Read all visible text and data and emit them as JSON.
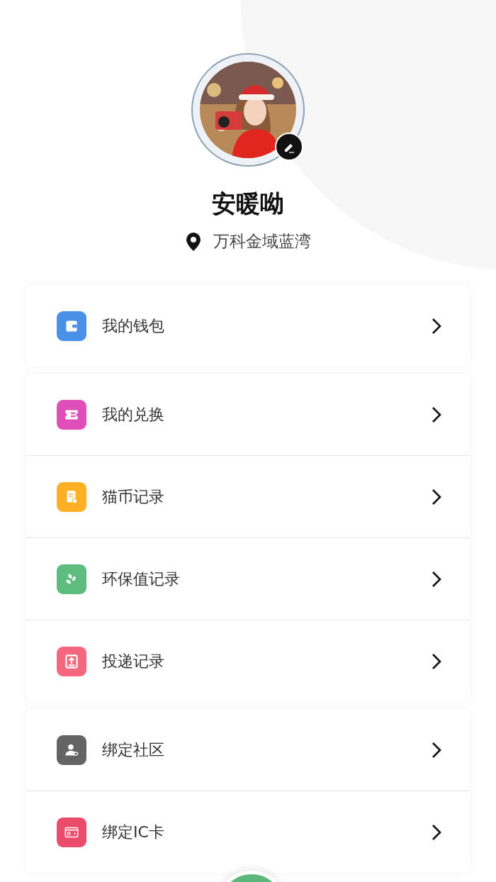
{
  "profile": {
    "name": "安暖呦",
    "location": "万科金域蓝湾"
  },
  "menu_groups": [
    {
      "items": [
        {
          "kind": "wallet",
          "label": "我的钱包"
        }
      ]
    },
    {
      "items": [
        {
          "kind": "ticket",
          "label": "我的兑换"
        },
        {
          "kind": "document",
          "label": "猫币记录"
        },
        {
          "kind": "leaf",
          "label": "环保值记录"
        },
        {
          "kind": "upload",
          "label": "投递记录"
        }
      ]
    },
    {
      "items": [
        {
          "kind": "user-link",
          "label": "绑定社区"
        },
        {
          "kind": "card",
          "label": "绑定IC卡"
        }
      ]
    }
  ]
}
